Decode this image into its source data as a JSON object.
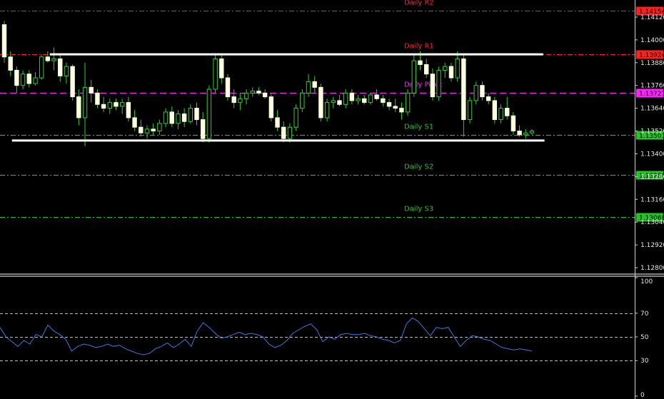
{
  "chart_data": [
    {
      "type": "candlestick",
      "ylim": [
        1.1277,
        1.1421
      ],
      "price_ticks": [
        "1.14120",
        "1.14000",
        "1.13880",
        "1.13760",
        "1.13640",
        "1.13520",
        "1.13400",
        "1.13280",
        "1.13160",
        "1.13040",
        "1.12920",
        "1.12800"
      ],
      "pivot_levels": [
        {
          "name": "Daily R2",
          "value": 1.14154,
          "tag": "1.14154",
          "color": "#ff2020"
        },
        {
          "name": "Daily R1",
          "value": 1.13924,
          "tag": "1.13924",
          "color": "#ff2020"
        },
        {
          "name": "Daily Pivot",
          "value": 1.13721,
          "tag": "1.13721",
          "color": "#ff20ff"
        },
        {
          "name": "Daily S1",
          "value": 1.13501,
          "tag": "1.13501",
          "color": "#22c522"
        },
        {
          "name": "Daily S2",
          "value": 1.13288,
          "tag": "1.13288",
          "color": "#22c522"
        },
        {
          "name": "Daily S3",
          "value": 1.13068,
          "tag": "1.13068",
          "color": "#22c522"
        }
      ],
      "channel_lines": [
        {
          "name": "resistance-line",
          "value": 1.13924,
          "x_from": 0.075,
          "x_to": 0.818
        },
        {
          "name": "support-line",
          "value": 1.1347,
          "x_from": 0.018,
          "x_to": 0.82
        }
      ],
      "candles": [
        [
          1.1408,
          1.141,
          1.1388,
          1.1391
        ],
        [
          1.1391,
          1.1394,
          1.1381,
          1.1384
        ],
        [
          1.1384,
          1.1386,
          1.1372,
          1.1376
        ],
        [
          1.1376,
          1.1384,
          1.1374,
          1.1382
        ],
        [
          1.1382,
          1.1384,
          1.1375,
          1.1377
        ],
        [
          1.1377,
          1.1383,
          1.1376,
          1.138
        ],
        [
          1.138,
          1.1392,
          1.1379,
          1.1391
        ],
        [
          1.1391,
          1.1394,
          1.1388,
          1.1389
        ],
        [
          1.1389,
          1.1396,
          1.1384,
          1.139
        ],
        [
          1.139,
          1.1392,
          1.1378,
          1.1381
        ],
        [
          1.1381,
          1.1388,
          1.1377,
          1.1386
        ],
        [
          1.1386,
          1.1387,
          1.1368,
          1.137
        ],
        [
          1.137,
          1.1374,
          1.1355,
          1.1359
        ],
        [
          1.1359,
          1.1388,
          1.1344,
          1.1375
        ],
        [
          1.1375,
          1.1379,
          1.1367,
          1.1372
        ],
        [
          1.1372,
          1.1374,
          1.1364,
          1.1366
        ],
        [
          1.1366,
          1.137,
          1.1362,
          1.1364
        ],
        [
          1.1364,
          1.1369,
          1.1361,
          1.1367
        ],
        [
          1.1367,
          1.1369,
          1.1363,
          1.1365
        ],
        [
          1.1365,
          1.1369,
          1.1361,
          1.1367
        ],
        [
          1.1367,
          1.137,
          1.1357,
          1.1359
        ],
        [
          1.1359,
          1.1363,
          1.1352,
          1.1354
        ],
        [
          1.1354,
          1.1358,
          1.1349,
          1.1351
        ],
        [
          1.1351,
          1.1355,
          1.1348,
          1.1353
        ],
        [
          1.1353,
          1.1356,
          1.135,
          1.1352
        ],
        [
          1.1352,
          1.1358,
          1.135,
          1.1356
        ],
        [
          1.1356,
          1.1364,
          1.1354,
          1.1362
        ],
        [
          1.1362,
          1.1365,
          1.1354,
          1.1356
        ],
        [
          1.1356,
          1.1363,
          1.1353,
          1.1361
        ],
        [
          1.1361,
          1.1364,
          1.1354,
          1.1357
        ],
        [
          1.1357,
          1.1366,
          1.1356,
          1.1364
        ],
        [
          1.1364,
          1.1367,
          1.1355,
          1.1358
        ],
        [
          1.1358,
          1.1362,
          1.1346,
          1.1348
        ],
        [
          1.1348,
          1.1376,
          1.1346,
          1.1374
        ],
        [
          1.1374,
          1.1393,
          1.1372,
          1.139
        ],
        [
          1.139,
          1.1393,
          1.1377,
          1.138
        ],
        [
          1.138,
          1.1382,
          1.1368,
          1.137
        ],
        [
          1.137,
          1.1374,
          1.1364,
          1.1367
        ],
        [
          1.1367,
          1.1372,
          1.1363,
          1.1369
        ],
        [
          1.1369,
          1.1374,
          1.1366,
          1.1372
        ],
        [
          1.1372,
          1.1375,
          1.137,
          1.1373
        ],
        [
          1.1373,
          1.1375,
          1.1371,
          1.1372
        ],
        [
          1.1372,
          1.1374,
          1.1369,
          1.137
        ],
        [
          1.137,
          1.1372,
          1.1357,
          1.1359
        ],
        [
          1.1359,
          1.1363,
          1.1352,
          1.1354
        ],
        [
          1.1354,
          1.1357,
          1.1346,
          1.1348
        ],
        [
          1.1348,
          1.1356,
          1.1346,
          1.1354
        ],
        [
          1.1354,
          1.1366,
          1.1352,
          1.1364
        ],
        [
          1.1364,
          1.1374,
          1.1362,
          1.1372
        ],
        [
          1.1372,
          1.1382,
          1.137,
          1.1378
        ],
        [
          1.1378,
          1.1381,
          1.1372,
          1.1375
        ],
        [
          1.1375,
          1.1377,
          1.1357,
          1.1359
        ],
        [
          1.1359,
          1.1369,
          1.1357,
          1.1367
        ],
        [
          1.1367,
          1.137,
          1.1364,
          1.1368
        ],
        [
          1.1368,
          1.1371,
          1.1365,
          1.1366
        ],
        [
          1.1366,
          1.1374,
          1.1364,
          1.1372
        ],
        [
          1.1372,
          1.1374,
          1.1366,
          1.1368
        ],
        [
          1.1368,
          1.1371,
          1.1366,
          1.1369
        ],
        [
          1.1369,
          1.1371,
          1.1366,
          1.1367
        ],
        [
          1.1367,
          1.1372,
          1.1366,
          1.1371
        ],
        [
          1.1371,
          1.1374,
          1.1368,
          1.1369
        ],
        [
          1.1369,
          1.1371,
          1.1365,
          1.1367
        ],
        [
          1.1367,
          1.1369,
          1.1363,
          1.1365
        ],
        [
          1.1365,
          1.1369,
          1.1362,
          1.1364
        ],
        [
          1.1364,
          1.1367,
          1.1358,
          1.1362
        ],
        [
          1.1362,
          1.1374,
          1.136,
          1.1372
        ],
        [
          1.1372,
          1.1392,
          1.137,
          1.1389
        ],
        [
          1.1389,
          1.1394,
          1.1384,
          1.1387
        ],
        [
          1.1387,
          1.139,
          1.138,
          1.1382
        ],
        [
          1.1382,
          1.1385,
          1.1368,
          1.137
        ],
        [
          1.137,
          1.1386,
          1.1368,
          1.1384
        ],
        [
          1.1384,
          1.1388,
          1.138,
          1.1386
        ],
        [
          1.1386,
          1.1388,
          1.1378,
          1.138
        ],
        [
          1.138,
          1.1394,
          1.1378,
          1.139
        ],
        [
          1.139,
          1.1392,
          1.1349,
          1.1358
        ],
        [
          1.1358,
          1.137,
          1.1356,
          1.1368
        ],
        [
          1.1368,
          1.1378,
          1.1366,
          1.1376
        ],
        [
          1.1376,
          1.1378,
          1.1368,
          1.137
        ],
        [
          1.137,
          1.1372,
          1.1366,
          1.1368
        ],
        [
          1.1368,
          1.137,
          1.1356,
          1.1358
        ],
        [
          1.1358,
          1.1366,
          1.1356,
          1.1364
        ],
        [
          1.1364,
          1.137,
          1.1358,
          1.136
        ],
        [
          1.136,
          1.1362,
          1.135,
          1.1352
        ],
        [
          1.1352,
          1.1355,
          1.1349,
          1.135
        ],
        [
          1.135,
          1.1353,
          1.1348,
          1.1351
        ],
        [
          1.1351,
          1.1353,
          1.135,
          1.1352
        ]
      ]
    },
    {
      "type": "line",
      "ylim": [
        0,
        100
      ],
      "levels": [
        70,
        50,
        30
      ],
      "tick_labels": [
        "100",
        "70",
        "50",
        "30",
        "0"
      ],
      "line_color": "#3a78e0",
      "values": [
        58,
        50,
        46,
        42,
        47,
        44,
        52,
        50,
        60,
        55,
        52,
        48,
        38,
        42,
        44,
        43,
        41,
        42,
        44,
        42,
        43,
        40,
        38,
        36,
        35,
        36,
        40,
        42,
        45,
        41,
        44,
        48,
        42,
        55,
        62,
        58,
        53,
        49,
        50,
        52,
        54,
        52,
        53,
        52,
        50,
        44,
        41,
        43,
        47,
        53,
        56,
        59,
        61,
        56,
        46,
        50,
        48,
        52,
        53,
        52,
        52,
        53,
        51,
        50,
        48,
        47,
        45,
        47,
        61,
        66,
        63,
        57,
        51,
        58,
        57,
        58,
        50,
        42,
        47,
        51,
        50,
        48,
        47,
        44,
        41,
        40,
        39,
        40,
        39,
        38
      ]
    }
  ]
}
